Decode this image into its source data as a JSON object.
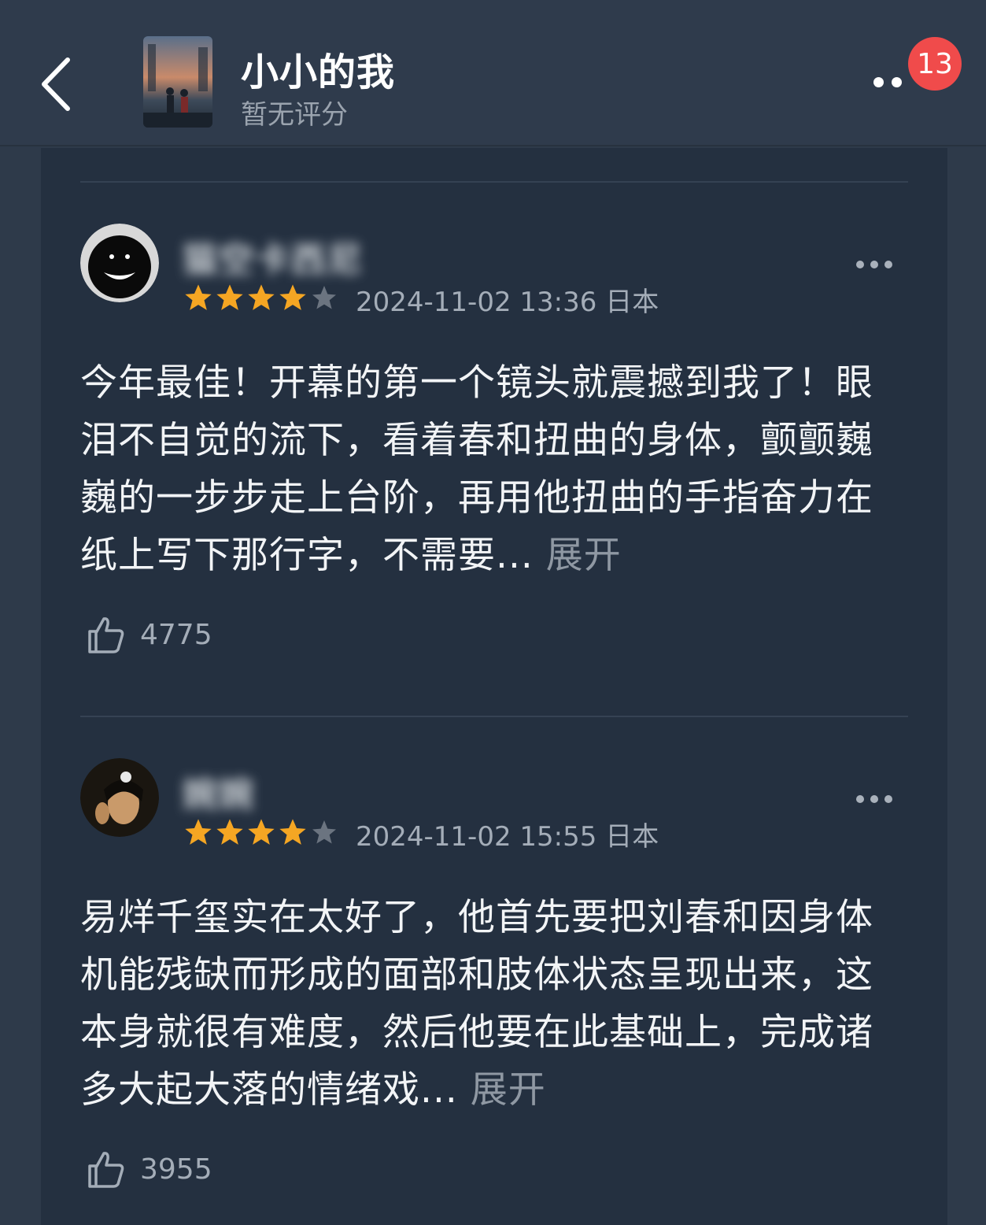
{
  "header": {
    "title": "小小的我",
    "rating_text": "暂无评分",
    "notification_count": "13"
  },
  "reviews": [
    {
      "username": "猫空卡西尼",
      "stars": 4,
      "max_stars": 5,
      "meta": "2024-11-02 13:36 日本",
      "content": "今年最佳！开幕的第一个镜头就震撼到我了！眼泪不自觉的流下，看着春和扭曲的身体，颤颤巍巍的一步步走上台阶，再用他扭曲的手指奋力在纸上写下那行字，不需要...",
      "expand_label": "展开",
      "likes": "4775"
    },
    {
      "username": "婉婉",
      "stars": 4,
      "max_stars": 5,
      "meta": "2024-11-02 15:55 日本",
      "content": "易烊千玺实在太好了，他首先要把刘春和因身体机能残缺而形成的面部和肢体状态呈现出来，这本身就很有难度，然后他要在此基础上，完成诸多大起大落的情绪戏...",
      "expand_label": "展开",
      "likes": "3955"
    }
  ],
  "colors": {
    "background": "#2e3a4a",
    "card": "#243040",
    "star_filled": "#f5a623",
    "star_empty": "#6b7480",
    "badge": "#f04b4b"
  }
}
